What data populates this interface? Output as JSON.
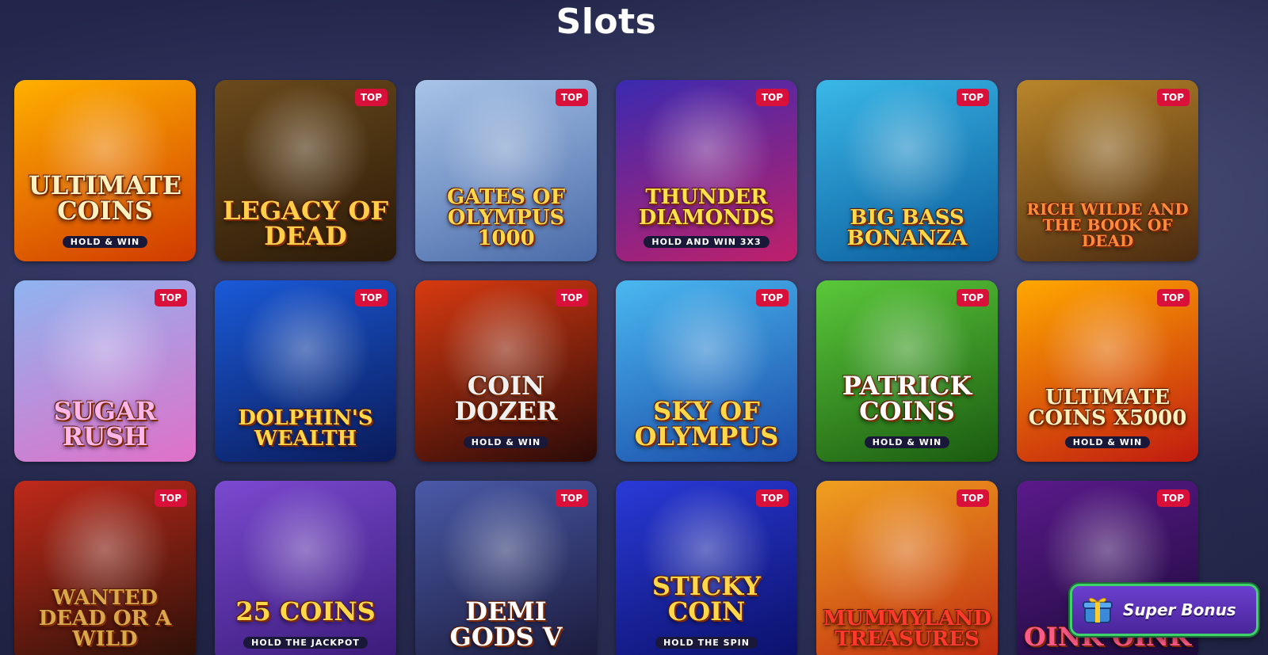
{
  "page": {
    "title": "Slots"
  },
  "badge_label": "TOP",
  "games": [
    {
      "title": "Ultimate Coins",
      "subtitle": "HOLD & WIN",
      "top": false,
      "bg": [
        "#ffb000",
        "#d03a00"
      ],
      "title_color": "#fff2c0"
    },
    {
      "title": "Legacy of Dead",
      "subtitle": "",
      "top": true,
      "bg": [
        "#6b4a1c",
        "#2a1a08"
      ],
      "title_color": "#ffcf4a"
    },
    {
      "title": "Gates of Olympus 1000",
      "subtitle": "",
      "top": true,
      "bg": [
        "#a8c4e8",
        "#4a6aa8"
      ],
      "title_color": "#ffd84a"
    },
    {
      "title": "Thunder Diamonds",
      "subtitle": "HOLD AND WIN 3x3",
      "top": true,
      "bg": [
        "#3a2ab0",
        "#c0206a"
      ],
      "title_color": "#ffe24a"
    },
    {
      "title": "Big Bass Bonanza",
      "subtitle": "",
      "top": true,
      "bg": [
        "#3ab8e8",
        "#0a5a9a"
      ],
      "title_color": "#ffd84a"
    },
    {
      "title": "Rich Wilde and the Book of Dead",
      "subtitle": "",
      "top": true,
      "bg": [
        "#b8862a",
        "#4a2a10"
      ],
      "title_color": "#ff8a3a"
    },
    {
      "title": "Sugar Rush",
      "subtitle": "",
      "top": true,
      "bg": [
        "#8fb4f0",
        "#e070c8"
      ],
      "title_color": "#ffb6e8"
    },
    {
      "title": "Dolphin's Wealth",
      "subtitle": "",
      "top": true,
      "bg": [
        "#1a5ad8",
        "#0a1a58"
      ],
      "title_color": "#ffd84a"
    },
    {
      "title": "Coin Dozer",
      "subtitle": "HOLD & WIN",
      "top": true,
      "bg": [
        "#d83a10",
        "#2a0a08"
      ],
      "title_color": "#f0f0f0"
    },
    {
      "title": "Sky of Olympus",
      "subtitle": "",
      "top": true,
      "bg": [
        "#4ab8f0",
        "#1a4aa8"
      ],
      "title_color": "#ffd84a"
    },
    {
      "title": "Patrick Coins",
      "subtitle": "HOLD & WIN",
      "top": true,
      "bg": [
        "#5ac83a",
        "#1a5a10"
      ],
      "title_color": "#ffffff"
    },
    {
      "title": "Ultimate Coins x5000",
      "subtitle": "HOLD & WIN",
      "top": true,
      "bg": [
        "#ffa800",
        "#c01a10"
      ],
      "title_color": "#fff2c0"
    },
    {
      "title": "Wanted Dead or a Wild",
      "subtitle": "",
      "top": true,
      "bg": [
        "#c02a1a",
        "#2a1008"
      ],
      "title_color": "#d8a84a"
    },
    {
      "title": "25 Coins",
      "subtitle": "HOLD THE JACKPOT",
      "top": false,
      "bg": [
        "#7a4ad0",
        "#3a1a78"
      ],
      "title_color": "#ffd84a"
    },
    {
      "title": "Demi Gods V",
      "subtitle": "",
      "top": true,
      "bg": [
        "#4a5aa8",
        "#1a1a3a"
      ],
      "title_color": "#ffffff"
    },
    {
      "title": "Sticky Coin",
      "subtitle": "HOLD THE SPIN",
      "top": true,
      "bg": [
        "#2a3ad8",
        "#0a1068"
      ],
      "title_color": "#ffd84a"
    },
    {
      "title": "Mummyland Treasures",
      "subtitle": "",
      "top": true,
      "bg": [
        "#f0a020",
        "#c02a10"
      ],
      "title_color": "#ff3a2a"
    },
    {
      "title": "Oink Oink",
      "subtitle": "",
      "top": true,
      "bg": [
        "#5a1a8a",
        "#1a0a38"
      ],
      "title_color": "#ff5a8a"
    }
  ],
  "super_bonus": {
    "label": "Super Bonus",
    "icon": "gift-icon"
  }
}
